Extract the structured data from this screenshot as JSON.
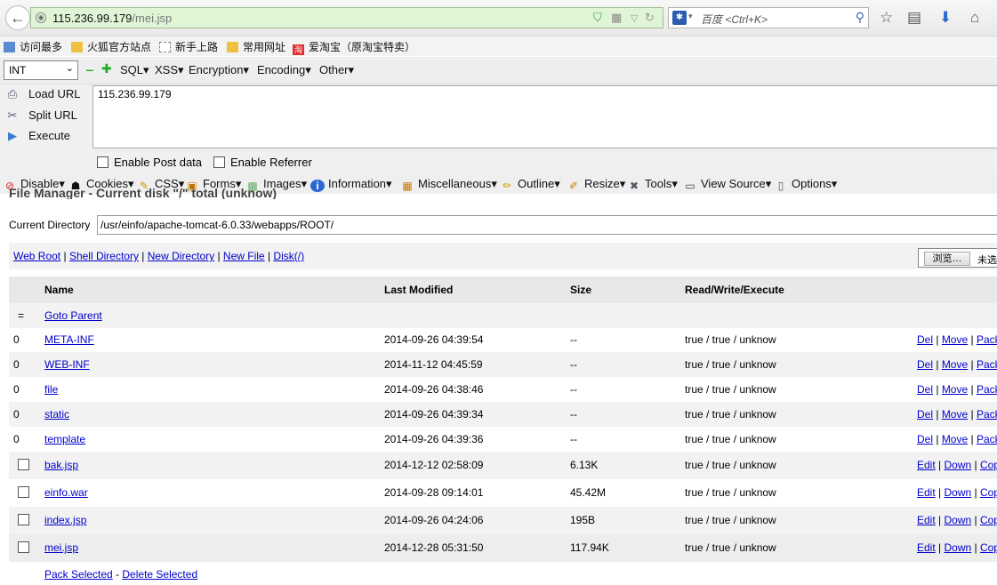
{
  "browser": {
    "url_host": "115.236.99.179",
    "url_path": "/mei.jsp",
    "search_placeholder": "百度 <Ctrl+K>"
  },
  "bookmarks": [
    {
      "label": "访问最多"
    },
    {
      "label": "火狐官方站点"
    },
    {
      "label": "新手上路"
    },
    {
      "label": "常用网址"
    },
    {
      "label": "爱淘宝（原淘宝特卖）"
    }
  ],
  "hackbar": {
    "select_value": "INT",
    "menus": [
      "SQL▾",
      "XSS▾",
      "Encryption▾",
      "Encoding▾",
      "Other▾"
    ],
    "actions": [
      "Load URL",
      "Split URL",
      "Execute"
    ],
    "url_text": "115.236.99.179",
    "checks": [
      "Enable Post data",
      "Enable Referrer"
    ]
  },
  "webdev": {
    "menus": [
      "Disable▾",
      "Cookies▾",
      "CSS▾",
      "Forms▾",
      "Images▾",
      "Information▾",
      "Miscellaneous▾",
      "Outline▾",
      "Resize▾",
      "Tools▾",
      "View Source▾",
      "Options▾"
    ]
  },
  "page": {
    "heading": "File Manager - Current disk \"/\" total (unknow)",
    "curdir_label": "Current Directory",
    "curdir_value": "/usr/einfo/apache-tomcat-6.0.33/webapps/ROOT/",
    "links": [
      "Web Root",
      "Shell Directory",
      "New Directory",
      "New File",
      "Disk(/)"
    ],
    "browse_button": "浏览…",
    "browse_status": "未选",
    "table_headers": [
      "Name",
      "Last Modified",
      "Size",
      "Read/Write/Execute"
    ],
    "parent_symbol": "=",
    "parent_label": "Goto Parent",
    "dirs": [
      {
        "icon": "0",
        "name": "META-INF",
        "modified": "2014-09-26 04:39:54",
        "size": "--",
        "rwx": "true / true / unknow"
      },
      {
        "icon": "0",
        "name": "WEB-INF",
        "modified": "2014-11-12 04:45:59",
        "size": "--",
        "rwx": "true / true / unknow"
      },
      {
        "icon": "0",
        "name": "file",
        "modified": "2014-09-26 04:38:46",
        "size": "--",
        "rwx": "true / true / unknow"
      },
      {
        "icon": "0",
        "name": "static",
        "modified": "2014-09-26 04:39:34",
        "size": "--",
        "rwx": "true / true / unknow"
      },
      {
        "icon": "0",
        "name": "template",
        "modified": "2014-09-26 04:39:36",
        "size": "--",
        "rwx": "true / true / unknow"
      }
    ],
    "dir_actions": [
      "Del",
      "Move",
      "Pack"
    ],
    "files": [
      {
        "name": "bak.jsp",
        "modified": "2014-12-12 02:58:09",
        "size": "6.13K",
        "rwx": "true / true / unknow"
      },
      {
        "name": "einfo.war",
        "modified": "2014-09-28 09:14:01",
        "size": "45.42M",
        "rwx": "true / true / unknow"
      },
      {
        "name": "index.jsp",
        "modified": "2014-09-26 04:24:06",
        "size": "195B",
        "rwx": "true / true / unknow"
      },
      {
        "name": "mei.jsp",
        "modified": "2014-12-28 05:31:50",
        "size": "117.94K",
        "rwx": "true / true / unknow"
      }
    ],
    "file_actions": [
      "Edit",
      "Down",
      "Copy"
    ],
    "bottom_links": [
      "Pack Selected",
      "Delete Selected"
    ]
  }
}
